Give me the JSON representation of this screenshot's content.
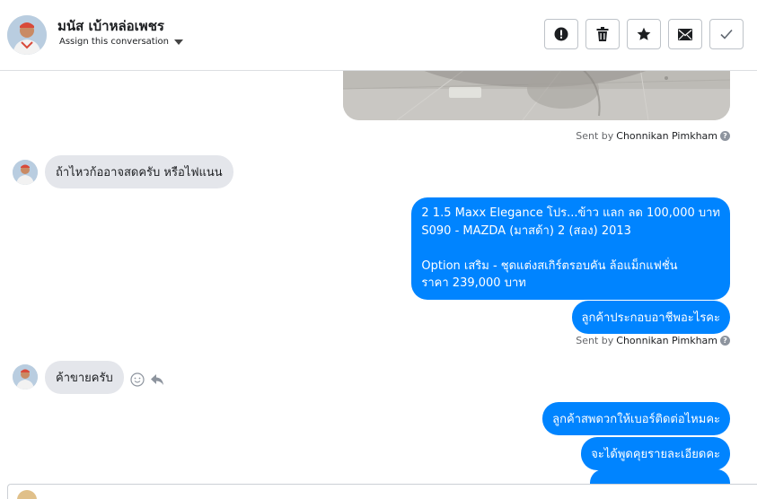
{
  "header": {
    "contact_name": "มนัส เบ้าหล่อเพชร",
    "assign_label": "Assign this conversation",
    "actions": [
      {
        "name": "mark-spam-button",
        "icon": "exclamation-icon"
      },
      {
        "name": "delete-button",
        "icon": "trash-icon"
      },
      {
        "name": "star-button",
        "icon": "star-icon"
      },
      {
        "name": "mark-unread-button",
        "icon": "envelope-icon"
      },
      {
        "name": "mark-done-button",
        "icon": "check-icon"
      }
    ]
  },
  "messages": {
    "sent_prefix": "Sent by",
    "agent_name": "Chonnikan Pimkham",
    "m1": "ถ้าไหวก้ออาจสดครับ  หรือไฟแนน",
    "m2_lines": [
      "2 1.5 Maxx Elegance โปร...ข้าว แลก ลด 100,000 บาท",
      "S090 - MAZDA (มาสด้า) 2 (สอง) 2013",
      "",
      " Option เสริม - ชุดแต่งสเกิร์ตรอบคัน ล้อแม็กแฟชั่น",
      "ราคา 239,000 บาท"
    ],
    "m3": "ลูกค้าประกอบอาชีพอะไรคะ",
    "m4": "ค้าขายครับ",
    "m5": "ลูกค้าสพดวกให้เบอร์ติดต่อไหมคะ",
    "m6": "จะได้พูดคุยรายละเอียดคะ"
  },
  "colors": {
    "outgoing_bubble": "#0084ff",
    "incoming_bubble": "#e4e6eb"
  }
}
